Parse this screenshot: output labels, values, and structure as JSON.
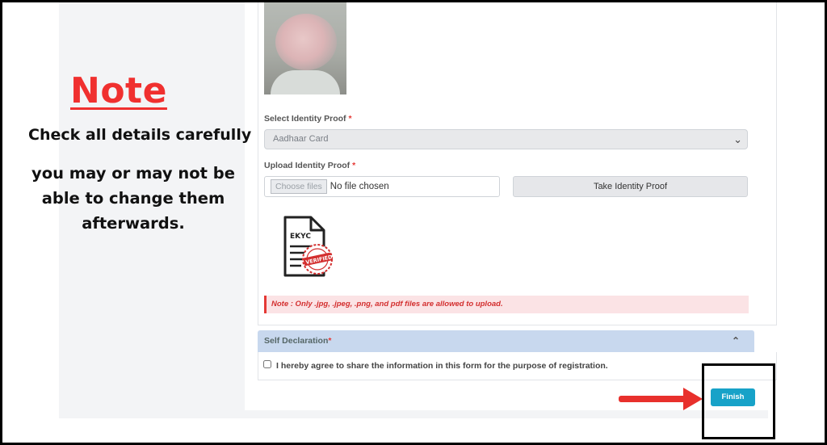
{
  "note": {
    "title": "Note",
    "line1": "Check all details carefully",
    "line2": "you may or may not be able to change them afterwards."
  },
  "form": {
    "identity_proof_label": "Select Identity Proof",
    "identity_proof_value": "Aadhaar Card",
    "upload_label": "Upload Identity Proof",
    "required_mark": "*",
    "choose_files": "Choose files",
    "no_file": "No file chosen",
    "take_identity_proof": "Take Identity Proof",
    "ekyc_label": "EKYC",
    "ekyc_stamp": "VERIFIED",
    "upload_note": "Note : Only .jpg, .jpeg, .png, and pdf files are allowed to upload."
  },
  "declaration": {
    "title": "Self Declaration",
    "checkbox_label": "I hereby agree to share the information in this form for the purpose of registration."
  },
  "actions": {
    "finish": "Finish"
  },
  "icons": [
    "chevron-down-icon",
    "chevron-up-icon",
    "ekyc-verified-icon",
    "red-arrow-icon"
  ],
  "colors": {
    "note_red": "#f0302f",
    "finish_blue": "#17a2c8",
    "declaration_header": "#c8d8ee",
    "note_bar_bg": "#fbe3e5"
  }
}
